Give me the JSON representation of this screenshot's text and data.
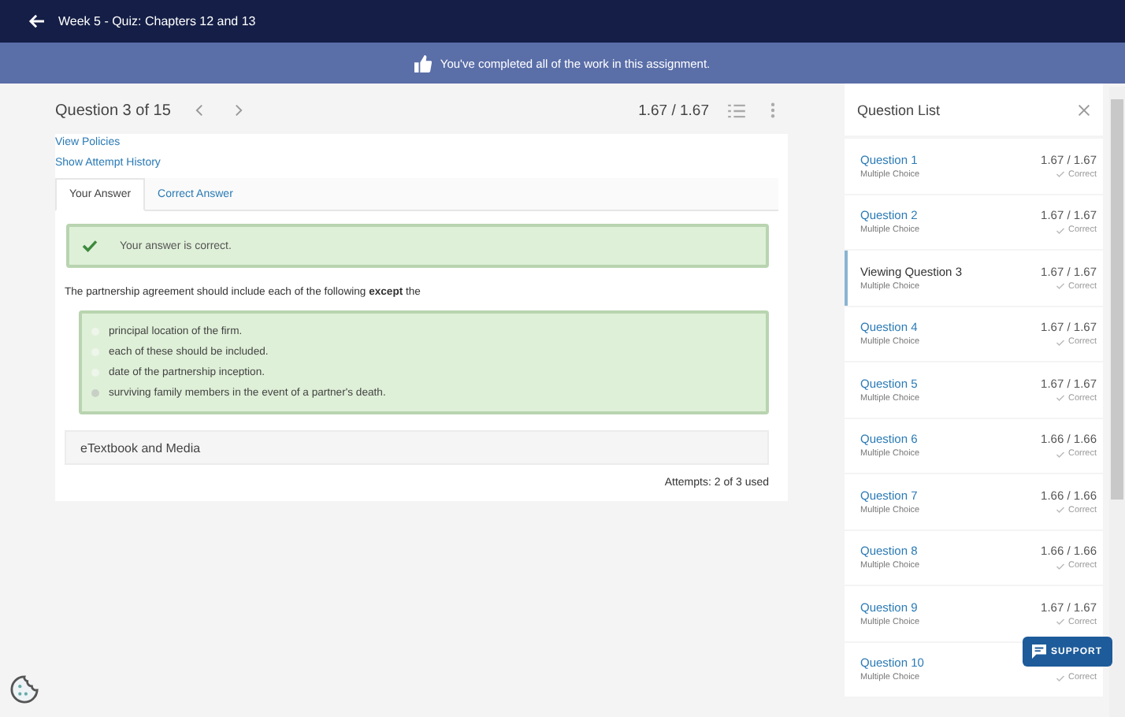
{
  "header": {
    "title": "Week 5 - Quiz: Chapters 12 and 13"
  },
  "banner": {
    "message": "You've completed all of the work in this assignment."
  },
  "question": {
    "position": "Question 3 of 15",
    "score": "1.67 / 1.67",
    "links": [
      "View Policies",
      "Show Attempt History"
    ],
    "tabs": [
      {
        "label": "Your Answer",
        "selected": true
      },
      {
        "label": "Correct Answer",
        "selected": false
      }
    ],
    "feedback": "Your answer is correct.",
    "prompt": "The partnership agreement should include each of the following **except** the",
    "options": [
      {
        "text": "principal location of the firm.",
        "selected": false
      },
      {
        "text": "each of these should be included.",
        "selected": false
      },
      {
        "text": "date of the partnership inception.",
        "selected": false
      },
      {
        "text": "surviving family members in the event of a partner's death.",
        "selected": true
      }
    ],
    "resources": "eTextbook and Media",
    "attempts": "Attempts: 2 of 3 used"
  },
  "question_list": {
    "title": "Question List",
    "items": [
      {
        "name": "Question 1",
        "type": "Multiple Choice",
        "score": "1.67 / 1.67",
        "status": "Correct",
        "selected": false
      },
      {
        "name": "Question 2",
        "type": "Multiple Choice",
        "score": "1.67 / 1.67",
        "status": "Correct",
        "selected": false
      },
      {
        "name": "Viewing Question 3",
        "type": "Multiple Choice",
        "score": "1.67 / 1.67",
        "status": "Correct",
        "selected": true
      },
      {
        "name": "Question 4",
        "type": "Multiple Choice",
        "score": "1.67 / 1.67",
        "status": "Correct",
        "selected": false
      },
      {
        "name": "Question 5",
        "type": "Multiple Choice",
        "score": "1.67 / 1.67",
        "status": "Correct",
        "selected": false
      },
      {
        "name": "Question 6",
        "type": "Multiple Choice",
        "score": "1.66 / 1.66",
        "status": "Correct",
        "selected": false
      },
      {
        "name": "Question 7",
        "type": "Multiple Choice",
        "score": "1.66 / 1.66",
        "status": "Correct",
        "selected": false
      },
      {
        "name": "Question 8",
        "type": "Multiple Choice",
        "score": "1.66 / 1.66",
        "status": "Correct",
        "selected": false
      },
      {
        "name": "Question 9",
        "type": "Multiple Choice",
        "score": "1.67 / 1.67",
        "status": "Correct",
        "selected": false
      },
      {
        "name": "Question 10",
        "type": "Multiple Choice",
        "status": "Correct",
        "selected": false
      }
    ]
  },
  "support": {
    "label": "SUPPORT"
  }
}
